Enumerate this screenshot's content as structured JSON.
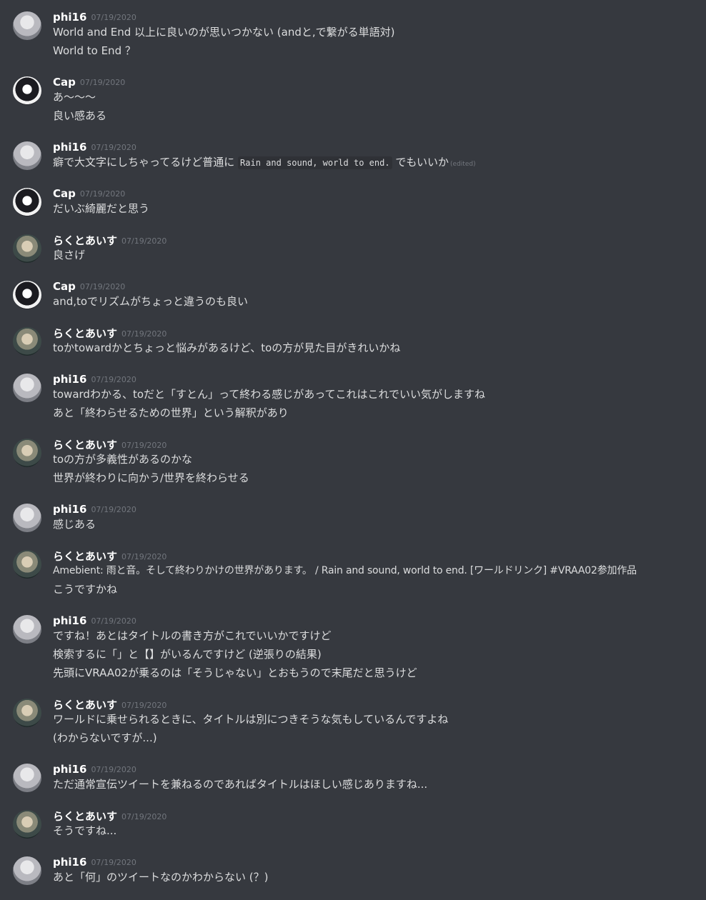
{
  "messages": [
    {
      "author": "phi16",
      "ts": "07/19/2020",
      "lines": [
        "World and End 以上に良いのが思いつかない (andと,で繋がる単語対)",
        "World to End ？"
      ]
    },
    {
      "author": "Cap",
      "ts": "07/19/2020",
      "lines": [
        "あ〜〜〜",
        "良い感ある"
      ]
    },
    {
      "author": "phi16",
      "ts": "07/19/2020",
      "prefix": "癖で大文字にしちゃってるけど普通に",
      "code": "Rain and sound, world to end.",
      "suffix": "でもいいか",
      "edited": "(edited)"
    },
    {
      "author": "Cap",
      "ts": "07/19/2020",
      "lines": [
        "だいぶ綺麗だと思う"
      ]
    },
    {
      "author": "らくとあいす",
      "ts": "07/19/2020",
      "lines": [
        "良さげ"
      ]
    },
    {
      "author": "Cap",
      "ts": "07/19/2020",
      "lines": [
        "and,toでリズムがちょっと違うのも良い"
      ]
    },
    {
      "author": "らくとあいす",
      "ts": "07/19/2020",
      "lines": [
        "toかtowardかとちょっと悩みがあるけど、toの方が見た目がきれいかね"
      ]
    },
    {
      "author": "phi16",
      "ts": "07/19/2020",
      "lines": [
        "towardわかる、toだと「すとん」って終わる感じがあってこれはこれでいい気がしますね",
        "あと「終わらせるための世界」という解釈があり"
      ]
    },
    {
      "author": "らくとあいす",
      "ts": "07/19/2020",
      "lines": [
        "toの方が多義性があるのかな",
        "世界が終わりに向かう/世界を終わらせる"
      ]
    },
    {
      "author": "phi16",
      "ts": "07/19/2020",
      "lines": [
        "感じある"
      ]
    },
    {
      "author": "らくとあいす",
      "ts": "07/19/2020",
      "lines": [
        "Amebient: 雨と音。そして終わりかけの世界があります。 / Rain and sound, world to end. [ワールドリンク] #VRAA02参加作品",
        "こうですかね"
      ]
    },
    {
      "author": "phi16",
      "ts": "07/19/2020",
      "lines": [
        "ですね！あとはタイトルの書き方がこれでいいかですけど",
        "検索するに「」と【】がいるんですけど (逆張りの結果)",
        "先頭にVRAA02が乗るのは「そうじゃない」とおもうので末尾だと思うけど"
      ]
    },
    {
      "author": "らくとあいす",
      "ts": "07/19/2020",
      "lines": [
        "ワールドに乗せられるときに、タイトルは別につきそうな気もしているんですよね",
        "(わからないですが...)"
      ]
    },
    {
      "author": "phi16",
      "ts": "07/19/2020",
      "lines": [
        "ただ通常宣伝ツイートを兼ねるのであればタイトルはほしい感じありますね..."
      ]
    },
    {
      "author": "らくとあいす",
      "ts": "07/19/2020",
      "lines": [
        "そうですね..."
      ]
    },
    {
      "author": "phi16",
      "ts": "07/19/2020",
      "lines": [
        "あと「何」のツイートなのかわからない (？)"
      ]
    }
  ]
}
